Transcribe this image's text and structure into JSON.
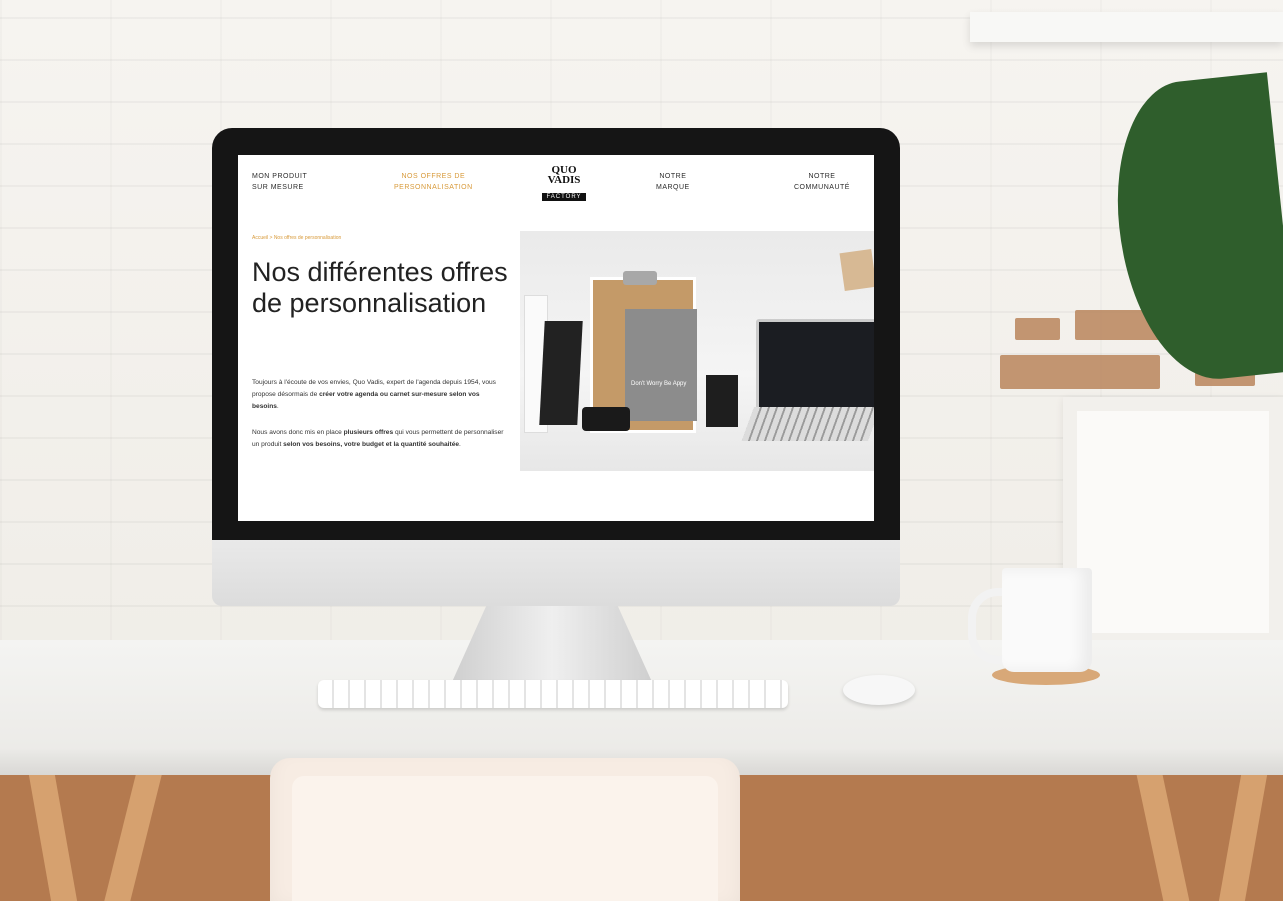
{
  "nav": {
    "items": [
      {
        "label_line1": "MON PRODUIT",
        "label_line2": "SUR MESURE"
      },
      {
        "label_line1": "NOS OFFRES DE",
        "label_line2": "PERSONNALISATION"
      },
      {
        "label_line1": "NOTRE",
        "label_line2": "MARQUE"
      },
      {
        "label_line1": "NOTRE",
        "label_line2": "COMMUNAUTÉ"
      }
    ],
    "active_index": 1
  },
  "logo": {
    "line1": "QUO",
    "line2": "VADIS",
    "badge": "FACTORY"
  },
  "breadcrumb": "Accueil > Nos offres de personnalisation",
  "hero": {
    "title": "Nos différentes offres de personnalisation",
    "paragraph1_plain": "Toujours à l'écoute de vos envies, Quo Vadis, expert de l'agenda depuis 1954, vous propose désormais de ",
    "paragraph1_bold": "créer votre agenda ou carnet sur-mesure selon vos besoins",
    "paragraph1_end": ".",
    "paragraph2_plain": "Nous avons donc mis en place ",
    "paragraph2_bold1": "plusieurs offres",
    "paragraph2_mid": " qui vous permettent de personnaliser un produit ",
    "paragraph2_bold2": "selon vos besoins, votre budget et la quantité souhaitée",
    "paragraph2_end": "."
  },
  "photo": {
    "notebook_text": "Don't Worry Be Appy"
  },
  "colors": {
    "accent": "#d89a3a",
    "text": "#222222",
    "screen_bg": "#ffffff"
  }
}
